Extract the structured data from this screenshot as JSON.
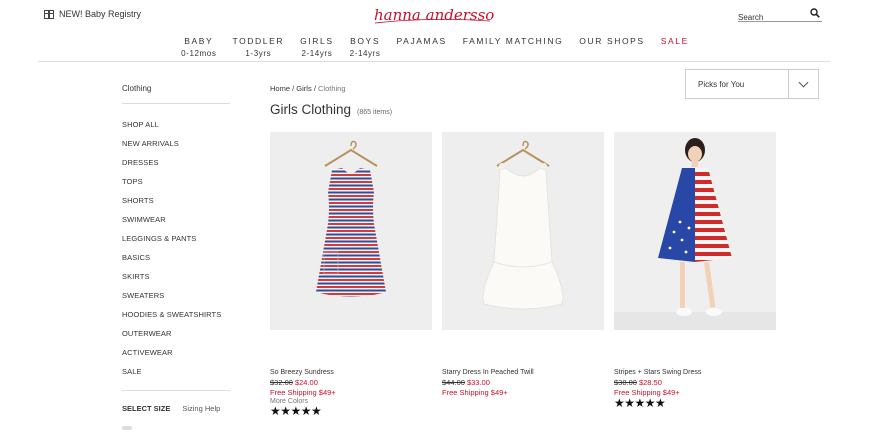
{
  "header": {
    "registry_label": "NEW! Baby Registry",
    "brand": "hanna andersson",
    "brand_color": "#c8102e",
    "search_placeholder": "Search"
  },
  "nav": [
    {
      "label": "BABY",
      "sub": "0-12mos"
    },
    {
      "label": "TODDLER",
      "sub": "1-3yrs"
    },
    {
      "label": "GIRLS",
      "sub": "2-14yrs"
    },
    {
      "label": "BOYS",
      "sub": "2-14yrs"
    },
    {
      "label": "PAJAMAS",
      "sub": ""
    },
    {
      "label": "FAMILY MATCHING",
      "sub": ""
    },
    {
      "label": "OUR SHOPS",
      "sub": ""
    },
    {
      "label": "SALE",
      "sub": ""
    }
  ],
  "sidebar": {
    "title": "Clothing",
    "items": [
      "SHOP ALL",
      "NEW ARRIVALS",
      "DRESSES",
      "TOPS",
      "SHORTS",
      "SWIMWEAR",
      "LEGGINGS & PANTS",
      "BASICS",
      "SKIRTS",
      "SWEATERS",
      "HOODIES & SWEATSHIRTS",
      "OUTERWEAR",
      "ACTIVEWEAR",
      "SALE"
    ],
    "select_size": "SELECT SIZE",
    "sizing_help": "Sizing Help"
  },
  "breadcrumb": {
    "home": "Home",
    "sep": "/",
    "girls": "Girls",
    "current": "Clothing"
  },
  "page": {
    "title": "Girls Clothing",
    "count": "(865 items)"
  },
  "sort": {
    "label": "Picks for You"
  },
  "products": [
    {
      "name": "So Breezy Sundress",
      "was": "$32.00",
      "now": "$24.00",
      "shipping": "Free Shipping $49+",
      "more": "More Colors",
      "stars": "★★★★★",
      "image_icon": "striped-dress-image"
    },
    {
      "name": "Starry Dress In Peached Twill",
      "was": "$44.00",
      "now": "$33.00",
      "shipping": "Free Shipping $49+",
      "more": "",
      "stars": "",
      "image_icon": "white-dress-image"
    },
    {
      "name": "Stripes + Stars Swing Dress",
      "was": "$38.00",
      "now": "$28.50",
      "shipping": "Free Shipping $49+",
      "more": "",
      "stars": "★★★★★",
      "image_icon": "flag-dress-image"
    }
  ]
}
